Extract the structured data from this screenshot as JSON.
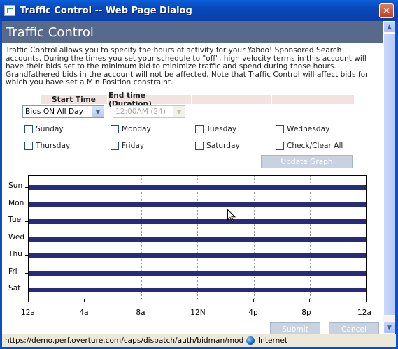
{
  "window": {
    "title": "Traffic Control -- Web Page Dialog",
    "close_glyph": "✕"
  },
  "page": {
    "heading": "Traffic Control",
    "description": "Traffic Control allows you to specify the hours of activity for your Yahoo! Sponsored Search accounts. During the times you set your schedule to \"off\", high velocity terms in this account will have their bids set to the minimum bid to minimize traffic and spend during those hours. Grandfathered bids in the account will not be affected. Note that Traffic Control will affect bids for which you have set a Min Position constraint."
  },
  "schedule": {
    "start_time_header": "Start Time",
    "end_time_header": "End time (Duration)",
    "start_value": "Bids ON All Day",
    "end_value": "12:00AM (24)",
    "days": [
      {
        "label": "Sunday",
        "checked": false
      },
      {
        "label": "Monday",
        "checked": false
      },
      {
        "label": "Tuesday",
        "checked": false
      },
      {
        "label": "Wednesday",
        "checked": false
      },
      {
        "label": "Thursday",
        "checked": false
      },
      {
        "label": "Friday",
        "checked": false
      },
      {
        "label": "Saturday",
        "checked": false
      }
    ],
    "check_all_label": "Check/Clear All",
    "update_button": "Update Graph"
  },
  "graph": {
    "y_labels": [
      "Sun",
      "Mon",
      "Tue",
      "Wed",
      "Thu",
      "Fri",
      "Sat"
    ],
    "x_labels": [
      "12a",
      "4a",
      "8a",
      "12N",
      "4p",
      "8p",
      "12a"
    ],
    "bar_color": "#262b7a"
  },
  "buttons": {
    "submit": "Submit",
    "cancel": "Cancel"
  },
  "statusbar": {
    "url": "https://demo.perf.overture.com/caps/dispatch/auth/bidman/modalChil",
    "zone": "Internet"
  },
  "scrollbar": {
    "up_glyph": "▲",
    "down_glyph": "▼"
  },
  "icons": {
    "select_arrow": "▼"
  }
}
